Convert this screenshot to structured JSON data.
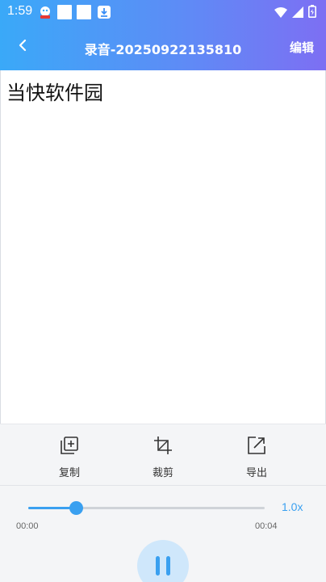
{
  "status_bar": {
    "time": "1:59",
    "icons": [
      "app-notification-icon",
      "square-icon",
      "square-icon",
      "download-icon",
      "wifi-icon",
      "signal-icon",
      "battery-icon"
    ]
  },
  "nav": {
    "back_icon": "chevron-left-icon",
    "title": "录音-20250922135810",
    "edit_label": "编辑"
  },
  "content": {
    "text": "当快软件园"
  },
  "toolbar": {
    "items": [
      {
        "label": "复制",
        "icon": "copy-icon"
      },
      {
        "label": "裁剪",
        "icon": "crop-icon"
      },
      {
        "label": "导出",
        "icon": "export-icon"
      }
    ]
  },
  "player": {
    "current_time": "00:00",
    "total_time": "00:04",
    "speed": "1.0x",
    "progress": 0.2,
    "state_icon": "pause-icon"
  },
  "colors": {
    "header_gradient_start": "#3aa9f8",
    "header_gradient_end": "#7d6ff3",
    "accent": "#3aa0f0",
    "panel_bg": "#f4f5f7"
  }
}
